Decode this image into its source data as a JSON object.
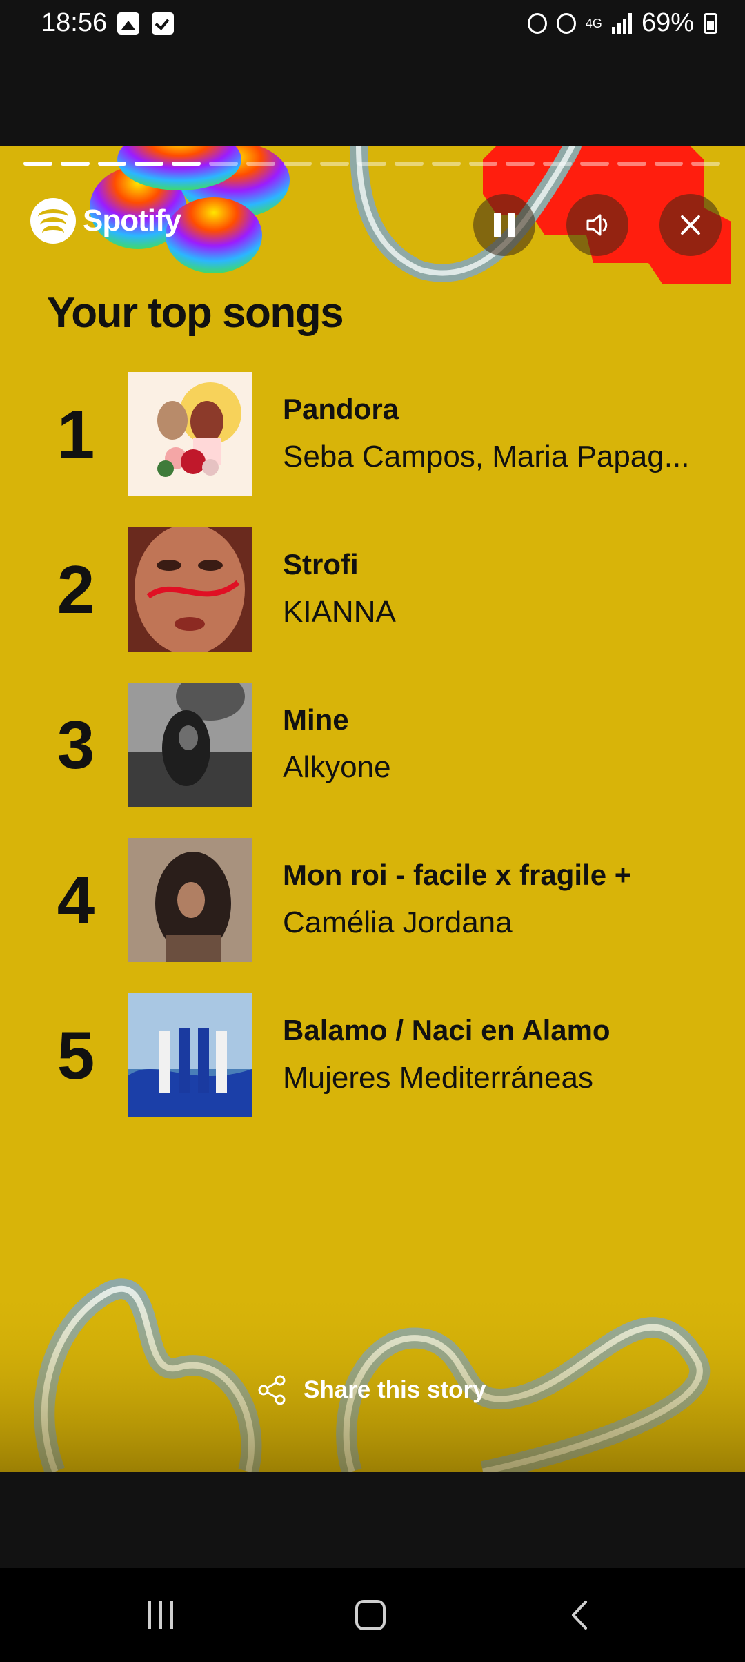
{
  "status_bar": {
    "time": "18:56",
    "battery": "69%",
    "network": "4G"
  },
  "story": {
    "brand": "Spotify",
    "heading": "Your top songs",
    "progress": {
      "segments": 19,
      "completed": 5
    },
    "share_label": "Share this story",
    "background_color": "#d8b409"
  },
  "songs": [
    {
      "rank": "1",
      "title": "Pandora",
      "artist": "Seba Campos, Maria Papag..."
    },
    {
      "rank": "2",
      "title": "Strofi",
      "artist": "KIANNA"
    },
    {
      "rank": "3",
      "title": "Mine",
      "artist": "Alkyone"
    },
    {
      "rank": "4",
      "title": "Mon roi - facile x fragile +",
      "artist": "Camélia Jordana"
    },
    {
      "rank": "5",
      "title": "Balamo / Naci en Alamo",
      "artist": "Mujeres Mediterráneas"
    }
  ],
  "icons": {
    "pause": "pause-icon",
    "audio_description": "audio-description-icon",
    "close": "close-icon",
    "share": "share-icon",
    "recents": "recents-icon",
    "home": "home-icon",
    "back": "back-icon"
  }
}
